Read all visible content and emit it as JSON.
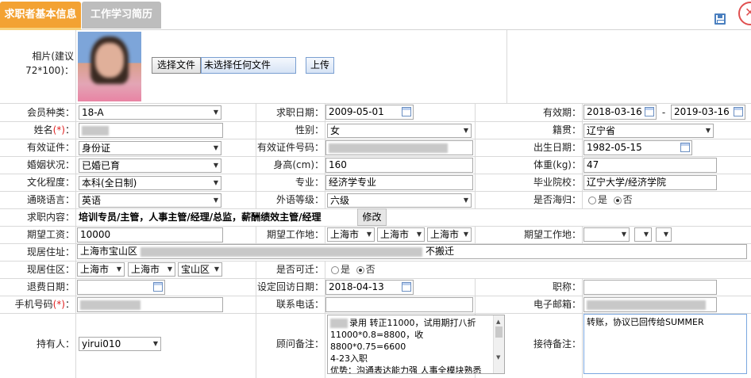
{
  "tabs": {
    "basic": "求职者基本信息",
    "history": "工作学习简历"
  },
  "icons": {
    "save": "save-icon",
    "close": "close-icon"
  },
  "photo": {
    "label": "相片(建议72*100)：",
    "choose_button": "选择文件",
    "no_file": "未选择任何文件",
    "upload_button": "上传"
  },
  "row1": {
    "member_type_label": "会员种类：",
    "member_type": "18-A",
    "apply_date_label": "求职日期：",
    "apply_date": "2009-05-01",
    "valid_label": "有效期：",
    "valid_from": "2018-03-16",
    "dash": "-",
    "valid_to": "2019-03-16"
  },
  "row2": {
    "name_label": "姓名",
    "required": "(*)",
    "colon": "：",
    "gender_label": "性别：",
    "gender": "女",
    "native_label": "籍贯：",
    "native": "辽宁省"
  },
  "row3": {
    "id_type_label": "有效证件：",
    "id_type": "身份证",
    "id_no_label": "有效证件号码：",
    "birth_label": "出生日期：",
    "birth": "1982-05-15"
  },
  "row4": {
    "marital_label": "婚姻状况：",
    "marital": "已婚已育",
    "height_label": "身高(cm)：",
    "height": "160",
    "weight_label": "体重(kg)：",
    "weight": "47"
  },
  "row5": {
    "edu_label": "文化程度：",
    "edu": "本科(全日制)",
    "major_label": "专业：",
    "major": "经济学专业",
    "school_label": "毕业院校：",
    "school": "辽宁大学/经济学院"
  },
  "row6": {
    "lang_label": "通晓语言：",
    "lang": "英语",
    "foreign_label": "外语等级：",
    "foreign": "六级",
    "overseas_label": "是否海归：",
    "yes": "是",
    "no": "否"
  },
  "row7": {
    "content_label": "求职内容：",
    "content": "培训专员/主管，人事主管/经理/总监，薪酬绩效主管/经理",
    "modify_button": "修改"
  },
  "row8": {
    "salary_label": "期望工资：",
    "salary": "10000",
    "workplace_label": "期望工作地：",
    "wp_province": "上海市",
    "wp_city": "上海市",
    "wp_district": "上海市",
    "workplace2_label": "期望工作地："
  },
  "row9": {
    "address_label": "现居住址：",
    "address_prefix": "上海市宝山区",
    "address_suffix": "不搬迁"
  },
  "row10": {
    "area_label": "现居住区：",
    "area_province": "上海市",
    "area_city": "上海市",
    "area_district": "宝山区",
    "relocate_label": "是否可迁：",
    "yes": "是",
    "no": "否"
  },
  "row11": {
    "refund_label": "退费日期：",
    "revisit_label": "设定回访日期：",
    "revisit": "2018-04-13",
    "title_label": "职称："
  },
  "row12": {
    "mobile_label": "手机号码",
    "required": "(*)",
    "colon": "：",
    "phone_label": "联系电话：",
    "email_label": "电子邮箱："
  },
  "row13": {
    "holder_label": "持有人：",
    "holder": "yirui010",
    "advisor_label": "顾问备注：",
    "advisor_lines": [
      "录用 转正11000，试用期打八折",
      "11000*0.8=8800，收8800*0.75=6600",
      "4-23入职",
      "优势：沟通表达能力强 人事全模块熟悉"
    ],
    "reception_label": "接待备注：",
    "reception": "转账，协议已回传给SUMMER"
  }
}
